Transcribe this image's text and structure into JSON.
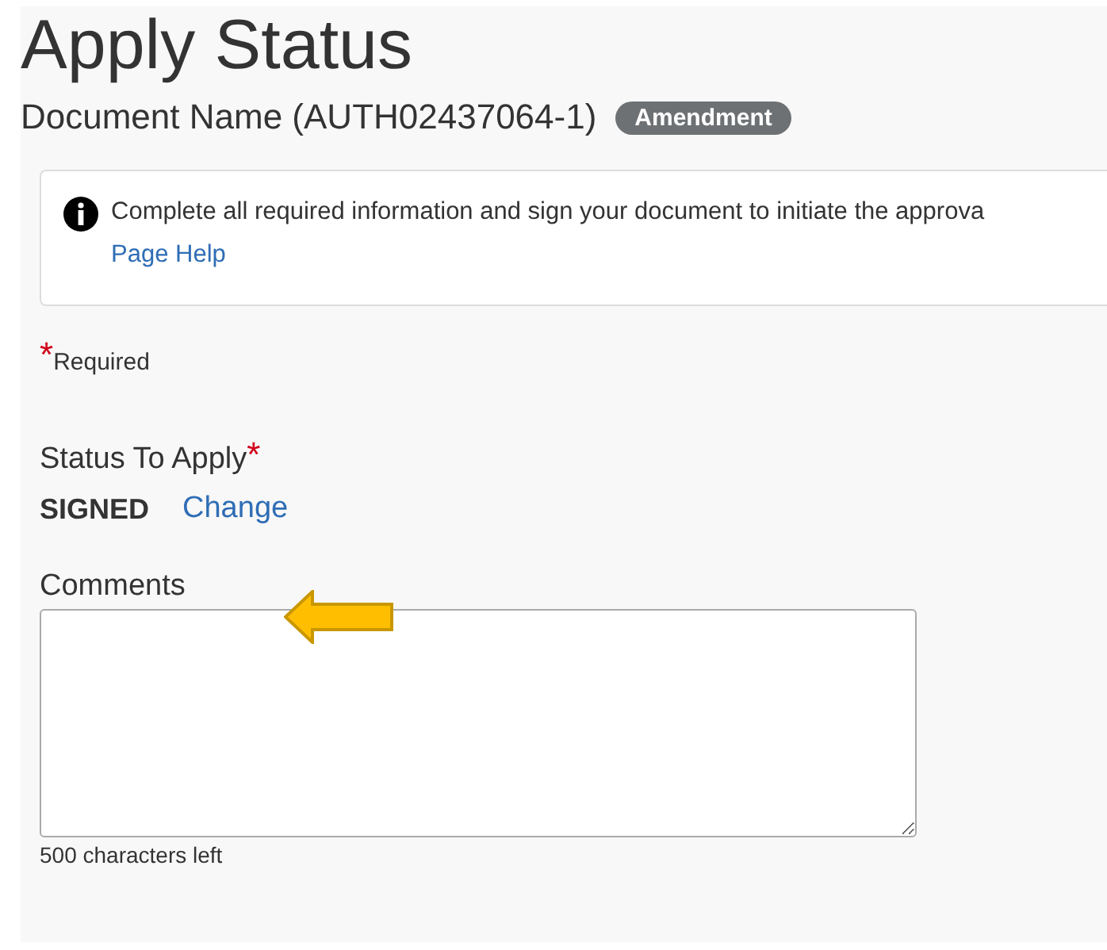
{
  "title": "Apply Status",
  "document": {
    "name": "Document Name (AUTH02437064-1)",
    "badge": "Amendment"
  },
  "info": {
    "message": "Complete all required information and sign your document to initiate the approva",
    "link": "Page Help"
  },
  "required_note": {
    "mark": "*",
    "label": "Required"
  },
  "status_field": {
    "label": "Status To Apply",
    "required_mark": "*",
    "value": "SIGNED",
    "action": "Change"
  },
  "comments": {
    "label": "Comments",
    "counter": "500 characters left"
  }
}
